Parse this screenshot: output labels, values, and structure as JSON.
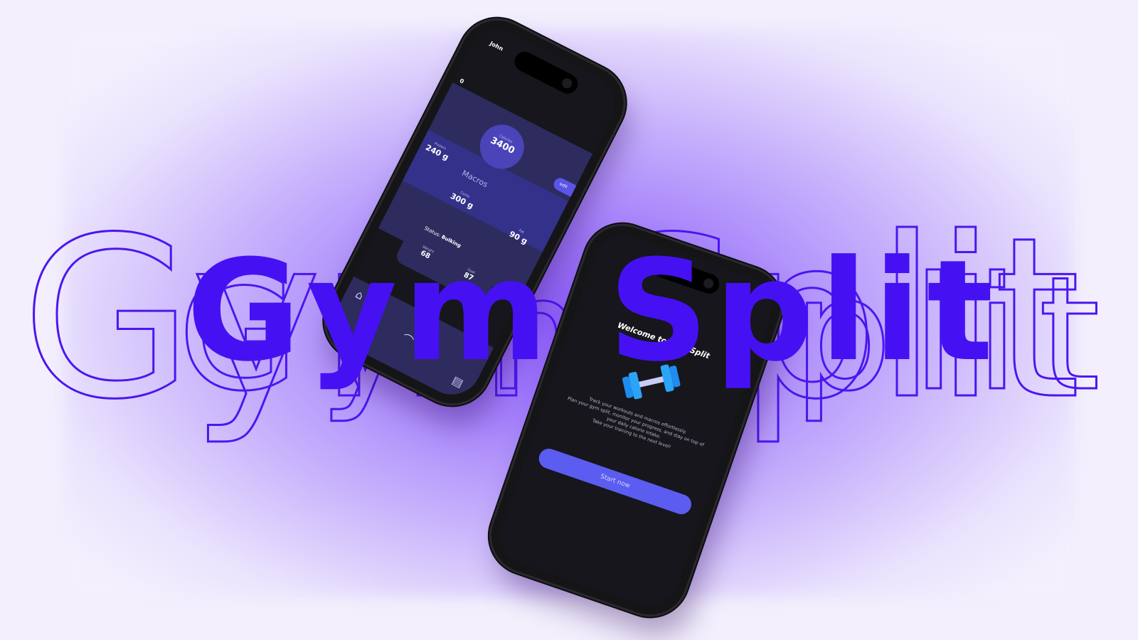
{
  "brand": {
    "title": "Gym Split",
    "accent_color": "#4511f2",
    "background_color": "#f3effd"
  },
  "dashboard_phone": {
    "user_name": "John",
    "counter": "0",
    "calories_label": "Calories",
    "calories_value": "3400",
    "edit_label": "edit",
    "macros_title": "Macros",
    "protein_label": "Protein",
    "protein_value": "240 g",
    "carbs_label": "Carbs",
    "carbs_value": "300 g",
    "fat_label": "Fat",
    "fat_value": "90 g",
    "status_label": "Status:",
    "status_value": "Bulking",
    "weight_label": "Weight",
    "weight_value": "68",
    "goal_label": "Goal",
    "goal_value": "87",
    "nav_icons": [
      "home-icon",
      "workout-icon",
      "progress-icon"
    ]
  },
  "welcome_phone": {
    "title": "Welcome to Gym Split",
    "icon": "dumbbell-icon",
    "description_lines": [
      "Track your workouts and macros effortlessly.",
      "Plan your gym split, monitor your progress, and stay on top of",
      "your daily calorie intake.",
      "Take your training to the next level!"
    ],
    "start_button": "Start now"
  }
}
